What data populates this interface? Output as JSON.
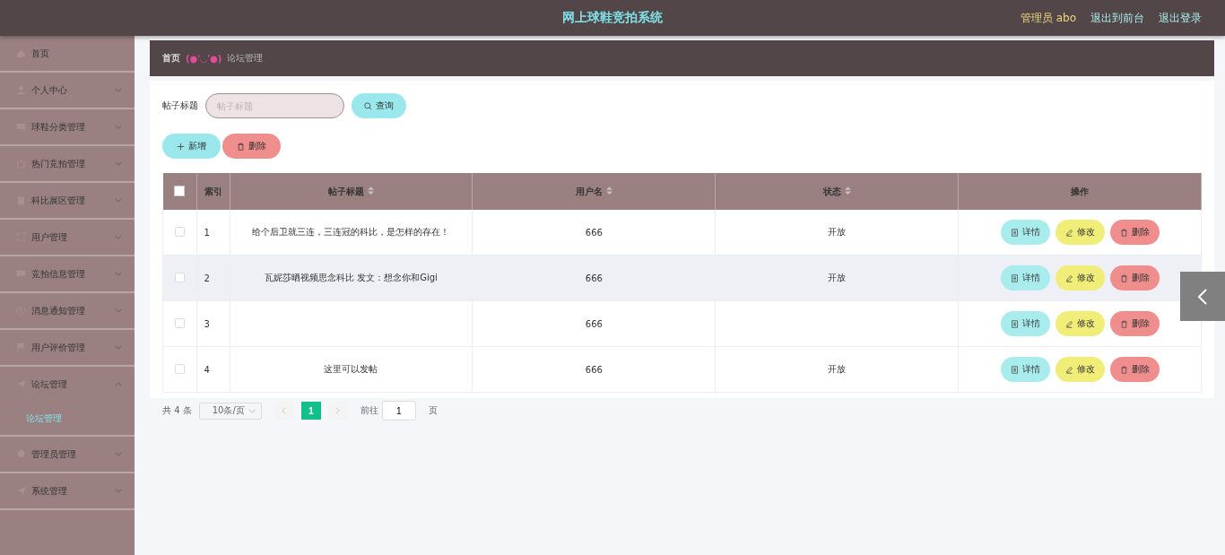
{
  "header": {
    "title": "网上球鞋竞拍系统",
    "user": "管理员 abo",
    "links": [
      "退出到前台",
      "退出登录"
    ]
  },
  "sidebar": {
    "items": [
      {
        "label": "首页",
        "kind": "link"
      },
      {
        "label": "个人中心",
        "kind": "menu",
        "expanded": false
      },
      {
        "label": "球鞋分类管理",
        "kind": "menu",
        "expanded": false
      },
      {
        "label": "热门竞拍管理",
        "kind": "menu",
        "expanded": false
      },
      {
        "label": "科比展区管理",
        "kind": "menu",
        "expanded": false
      },
      {
        "label": "用户管理",
        "kind": "menu",
        "expanded": false
      },
      {
        "label": "竞拍信息管理",
        "kind": "menu",
        "expanded": false
      },
      {
        "label": "消息通知管理",
        "kind": "menu",
        "expanded": false
      },
      {
        "label": "用户评价管理",
        "kind": "menu",
        "expanded": false
      },
      {
        "label": "论坛管理",
        "kind": "menu",
        "expanded": true,
        "children": [
          {
            "label": "论坛管理",
            "selected": true
          }
        ]
      },
      {
        "label": "管理员管理",
        "kind": "menu",
        "expanded": false
      },
      {
        "label": "系统管理",
        "kind": "menu",
        "expanded": false
      }
    ]
  },
  "breadcrumb": {
    "home": "首页",
    "separator": "(●'◡'●)",
    "current": "论坛管理"
  },
  "search": {
    "label": "帖子标题",
    "placeholder": "帖子标题",
    "button": "查询"
  },
  "actions": {
    "add": "新增",
    "delete": "删除"
  },
  "table": {
    "select_all": false,
    "columns": [
      {
        "label": "索引",
        "sortable": false
      },
      {
        "label": "帖子标题",
        "sortable": true
      },
      {
        "label": "用户名",
        "sortable": true
      },
      {
        "label": "状态",
        "sortable": true
      },
      {
        "label": "操作",
        "sortable": false
      }
    ],
    "rows": [
      {
        "checked": false,
        "hovered": false,
        "index": "1",
        "title": "给个后卫就三连，三连冠的科比，是怎样的存在！",
        "user": "666",
        "status": "开放",
        "buttons": [
          "详情",
          "修改",
          "删除"
        ]
      },
      {
        "checked": false,
        "hovered": true,
        "index": "2",
        "title": "瓦妮莎晒视频思念科比 发文：想念你和Gigi",
        "user": "666",
        "status": "开放",
        "buttons": [
          "详情",
          "修改",
          "删除"
        ]
      },
      {
        "checked": false,
        "hovered": false,
        "index": "3",
        "user": "666",
        "buttons": [
          "详情",
          "修改",
          "删除"
        ]
      },
      {
        "checked": false,
        "hovered": false,
        "index": "4",
        "title": "这里可以发帖",
        "user": "666",
        "status": "开放",
        "buttons": [
          "详情",
          "修改",
          "删除"
        ]
      }
    ]
  },
  "pagination": {
    "total": "共 4 条",
    "page_size": "10条/页",
    "pages": [
      {
        "label": "1",
        "selected": true
      }
    ],
    "goto_label": "前往",
    "goto_value": "1",
    "goto_suffix": "页"
  }
}
